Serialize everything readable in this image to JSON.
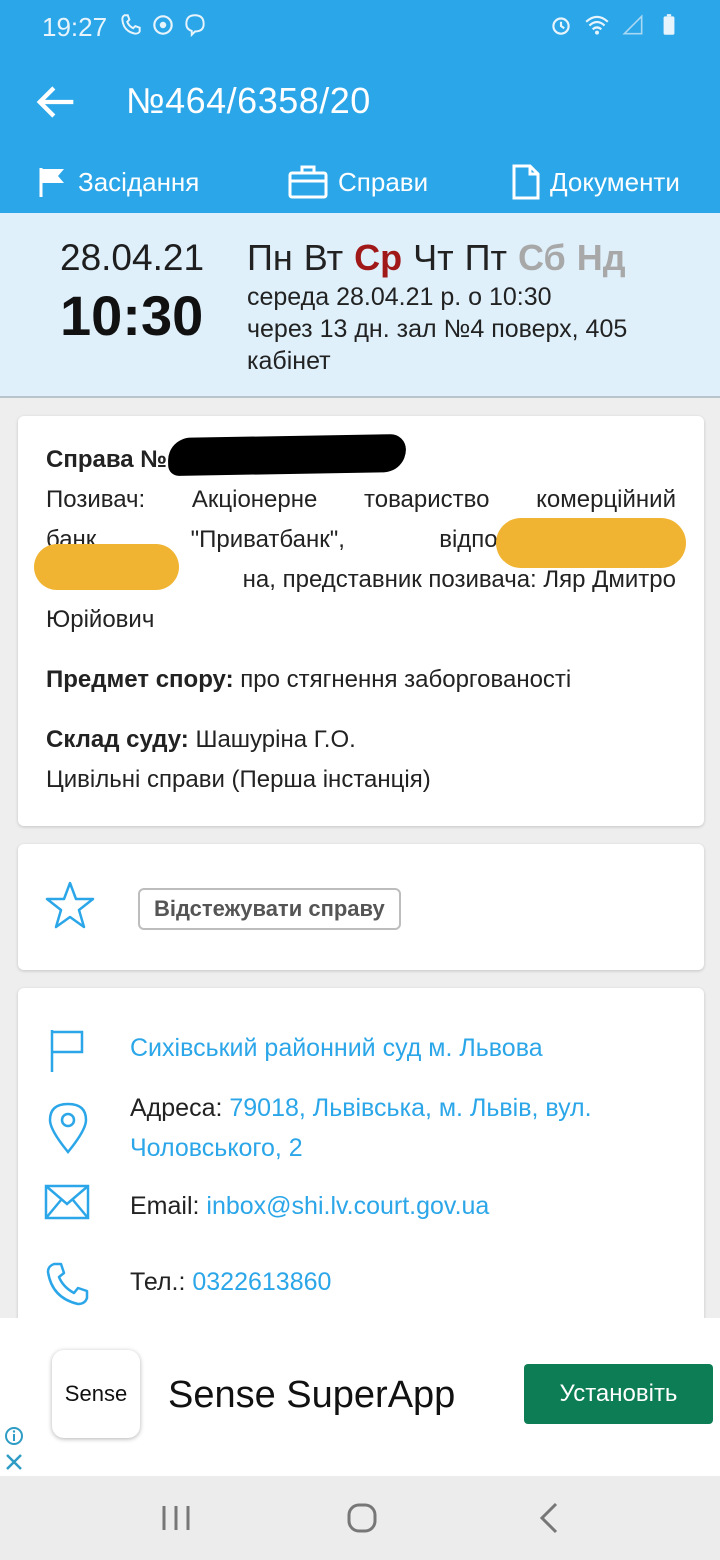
{
  "status": {
    "time": "19:27",
    "left_icons": [
      "phone-icon",
      "sync-icon",
      "viber-icon"
    ],
    "right_icons": [
      "alarm-icon",
      "wifi-icon",
      "signal-icon",
      "battery-icon"
    ]
  },
  "appbar": {
    "title": "№464/6358/20",
    "back_icon": "arrow-left-icon"
  },
  "tabs": [
    {
      "label": "Засідання",
      "icon": "flag-icon"
    },
    {
      "label": "Справи",
      "icon": "briefcase-icon"
    },
    {
      "label": "Документи",
      "icon": "document-icon"
    }
  ],
  "hearing": {
    "date": "28.04.21",
    "time": "10:30",
    "weekdays": [
      "Пн",
      "Вт",
      "Ср",
      "Чт",
      "Пт",
      "Сб",
      "Нд"
    ],
    "active_day": "Ср",
    "line1": "середа 28.04.21 р. о 10:30",
    "line2": "через 13 дн. зал №4 поверх, 405",
    "line3": "кабінет"
  },
  "case": {
    "number_label": "Справа №",
    "parties_line1": "Позивач: Акціонерне товариство комерційний",
    "parties_line2": "банк \"Приватбанк\", відповідач: М",
    "parties_line3": "на, представник позивача: Ляр Дмитро",
    "parties_line4": "Юрійович",
    "subject_label": "Предмет спору:",
    "subject_value": " про стягнення заборгованості",
    "court_label": "Склад суду:",
    "court_value": " Шашуріна Г.О.",
    "category": "Цивільні справи (Перша інстанція)"
  },
  "track": {
    "button_label": "Відстежувати справу",
    "icon": "star-icon"
  },
  "court": {
    "name": "Сихівський районний суд м. Львова",
    "address_label": "Адреса: ",
    "address_value_1": "79018, Львівська, м. Львів, вул.",
    "address_value_2": "Чоловського, 2",
    "email_label": "Email: ",
    "email_value": "inbox@shi.lv.court.gov.ua",
    "phone_label": "Тел.: ",
    "phone_value": "0322613860"
  },
  "ad": {
    "logo_text": "Sense",
    "title": "Sense SuperApp",
    "button_label": "Установіть"
  },
  "colors": {
    "primary": "#2ba6e8",
    "active_day": "#a01818",
    "ad_button": "#0c7d54"
  }
}
